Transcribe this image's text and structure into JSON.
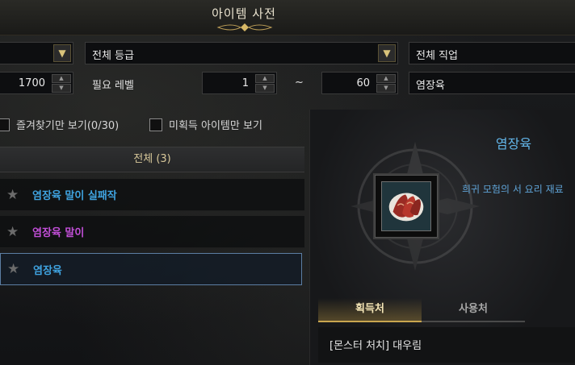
{
  "window": {
    "title": "아이템 사전"
  },
  "filters": {
    "type_select": {
      "value": ""
    },
    "grade_select": {
      "value": "전체 등급"
    },
    "class_select": {
      "value": "전체 직업"
    },
    "min_value": "1700",
    "level_label": "필요 레벨",
    "level_min": "1",
    "tilde": "~",
    "level_max": "60",
    "search_value": "염장육",
    "favorites_label": "즐겨찾기만 보기(0/30)",
    "unacquired_label": "미획득 아이템만 보기"
  },
  "list": {
    "header": "전체 (3)",
    "items": [
      {
        "name": "염장육 말이 실패작",
        "color": "#3fa3e0"
      },
      {
        "name": "염장육 말이",
        "color": "#c24fd8"
      },
      {
        "name": "염장육",
        "color": "#3fa3e0",
        "selected": true
      }
    ]
  },
  "detail": {
    "name": "염장육",
    "subtitle": "희귀 모험의 서 요리 재료",
    "icon": "meat-icon",
    "tabs": [
      "획득처",
      "사용처"
    ],
    "active_tab": "획득처",
    "sources": [
      "[몬스터 처치] 대우림"
    ]
  },
  "colors": {
    "accent_gold": "#c9a64f",
    "rare_blue": "#3fa3e0",
    "epic_purple": "#c24fd8"
  }
}
